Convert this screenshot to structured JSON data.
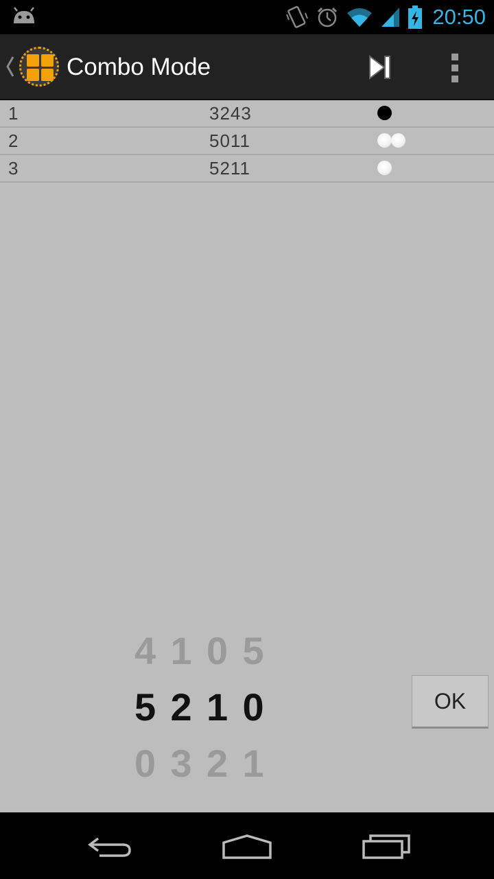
{
  "status_bar": {
    "time": "20:50",
    "icons": [
      "android-notification-icon",
      "vibrate-icon",
      "alarm-icon",
      "wifi-icon",
      "signal-icon",
      "battery-charging-icon"
    ]
  },
  "action_bar": {
    "title": "Combo Mode",
    "icons": [
      "up-caret-icon",
      "app-grid-icon",
      "skip-next-icon",
      "overflow-menu-icon"
    ]
  },
  "guesses": [
    {
      "index": "1",
      "code": "3243",
      "feedback": {
        "black": 1,
        "white": 0
      }
    },
    {
      "index": "2",
      "code": "5011",
      "feedback": {
        "black": 0,
        "white": 2
      }
    },
    {
      "index": "3",
      "code": "5211",
      "feedback": {
        "black": 0,
        "white": 1
      }
    }
  ],
  "picker": {
    "above": [
      "4",
      "1",
      "0",
      "5"
    ],
    "selected": [
      "5",
      "2",
      "1",
      "0"
    ],
    "below": [
      "0",
      "3",
      "2",
      "1"
    ]
  },
  "ok_button": {
    "label": "OK"
  },
  "nav_bar": {
    "icons": [
      "back-icon",
      "home-icon",
      "recent-apps-icon"
    ]
  },
  "colors": {
    "accent_blue": "#33b5e5",
    "icon_orange": "#f3a10a",
    "content_bg": "#bdbdbd",
    "action_bar_bg": "#222222"
  }
}
